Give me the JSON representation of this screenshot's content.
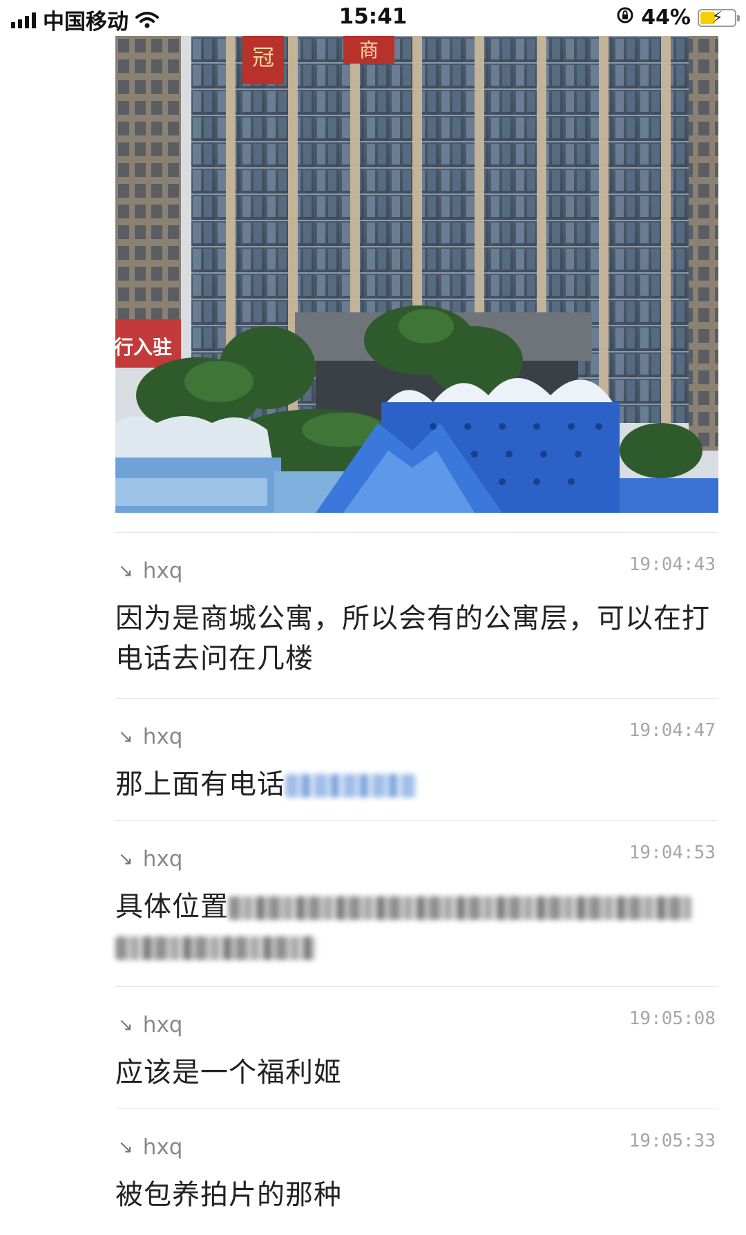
{
  "status_bar": {
    "carrier": "中国移动",
    "time": "15:41",
    "battery_percent": "44%",
    "battery_level": 0.44,
    "icons": [
      "signal-icon",
      "wifi-icon",
      "orientation-lock-icon",
      "battery-charging-icon"
    ]
  },
  "photo": {
    "banner_1": "冠",
    "banner_2": "商",
    "sign_text": "行入驻"
  },
  "reply_glyph": "↘",
  "comments": [
    {
      "user": "hxq",
      "time": "19:04:43",
      "text": "因为是商城公寓，所以会有的公寓层，可以在打电话去问在几楼"
    },
    {
      "user": "hxq",
      "time": "19:04:47",
      "text": "那上面有电话"
    },
    {
      "user": "hxq",
      "time": "19:04:53",
      "text": "具体位置"
    },
    {
      "user": "hxq",
      "time": "19:05:08",
      "text": "应该是一个福利姬"
    },
    {
      "user": "hxq",
      "time": "19:05:33",
      "text": "被包养拍片的那种"
    }
  ]
}
